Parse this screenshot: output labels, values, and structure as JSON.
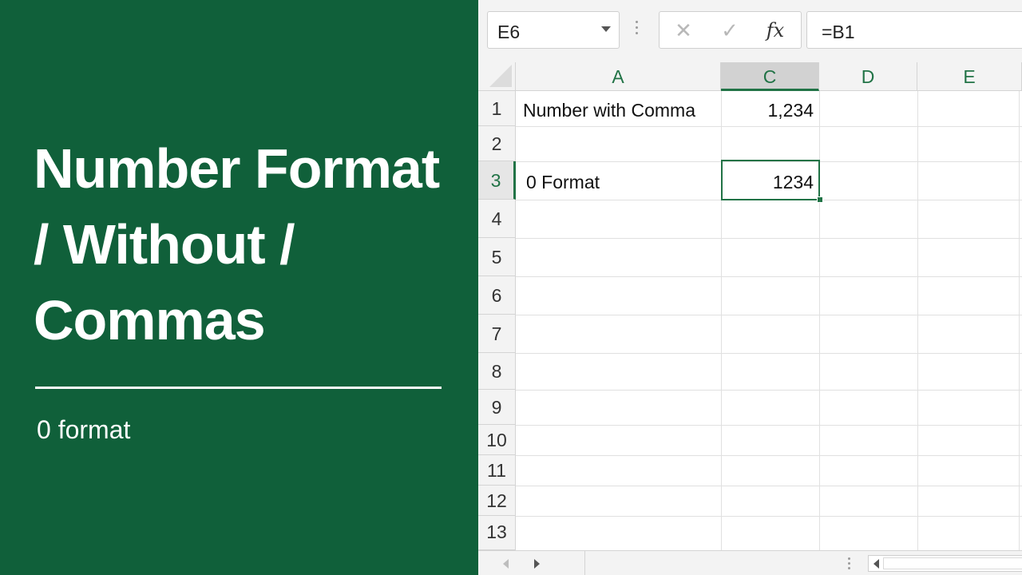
{
  "panel": {
    "title_lines": [
      "Number Format",
      "/ Without /",
      "Commas"
    ],
    "subtitle": "0 format",
    "background_color": "#10603a"
  },
  "spreadsheet": {
    "name_box": "E6",
    "formula_buttons": {
      "cancel_icon": "✕",
      "enter_icon": "✓",
      "function_icon": "fx"
    },
    "formula": "=B1",
    "columns": [
      "A",
      "C",
      "D",
      "E"
    ],
    "active_column": "C",
    "rows": [
      "1",
      "2",
      "3",
      "4",
      "5",
      "6",
      "7",
      "8",
      "9",
      "10",
      "11",
      "12",
      "13"
    ],
    "active_row": "3",
    "cells": {
      "A1": "Number with Comma",
      "C1": "1,234",
      "A3": "0 Format",
      "C3": "1234"
    },
    "selected_cell": "C3",
    "accent_color": "#217346"
  }
}
